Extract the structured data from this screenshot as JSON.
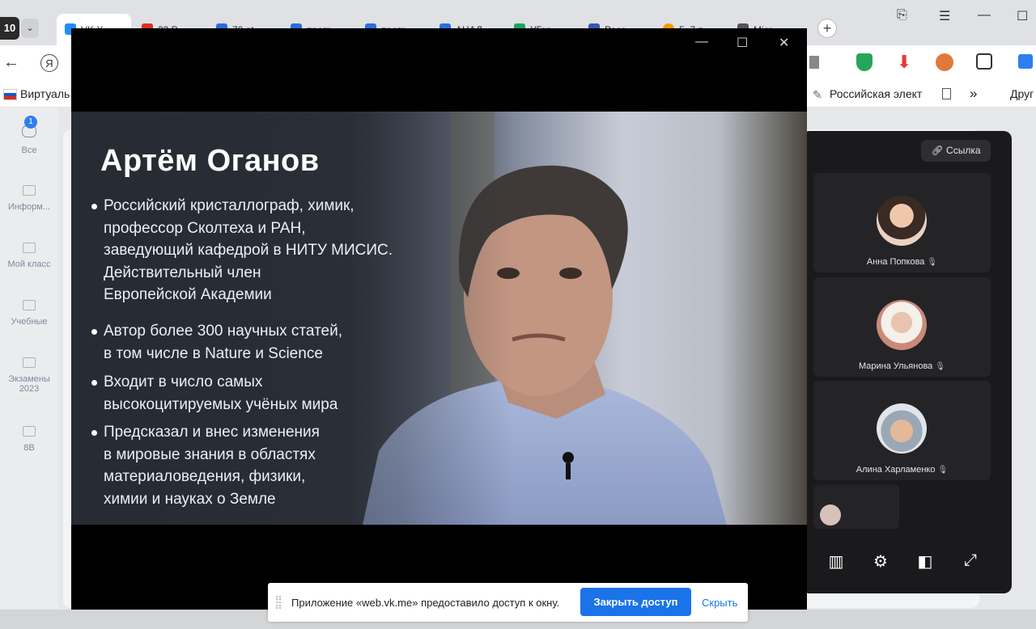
{
  "browser": {
    "tab_count_badge": "10",
    "tabs": [
      {
        "title": "VK X",
        "color": "#1f8cff",
        "active": true
      },
      {
        "title": "33 P",
        "color": "#d93025",
        "active": false
      },
      {
        "title": "70 at",
        "color": "#2a6de0",
        "active": false
      },
      {
        "title": "прогр",
        "color": "#2a6de0",
        "active": false
      },
      {
        "title": "прогр",
        "color": "#2a6de0",
        "active": false
      },
      {
        "title": "АНАЛ",
        "color": "#2a6de0",
        "active": false
      },
      {
        "title": "УГор",
        "color": "#1ea362",
        "active": false
      },
      {
        "title": "Росс",
        "color": "#3955b5",
        "active": false
      },
      {
        "title": "5. 7 п",
        "color": "#f29900",
        "active": false
      },
      {
        "title": "Micr",
        "color": "#555555",
        "active": false
      }
    ],
    "bookmarks": {
      "left": "Виртуаль",
      "right": "Российская элект",
      "more": "»",
      "other": "Друг"
    }
  },
  "sidebar": {
    "badge": "1",
    "items": [
      {
        "label": "Все"
      },
      {
        "label": "Информ..."
      },
      {
        "label": "Мой класс"
      },
      {
        "label": "Учебные"
      },
      {
        "label": "Экзамены 2023"
      },
      {
        "label": "8В"
      }
    ]
  },
  "call": {
    "link_label": "Ссылка",
    "participants": [
      {
        "name": "Анна Попкова"
      },
      {
        "name": "Марина Ульянова"
      },
      {
        "name": "Алина Харламенко"
      }
    ]
  },
  "video": {
    "slide_title": "Артём Оганов",
    "bullets": [
      [
        "Российский кристаллограф, химик,",
        "профессор Сколтеха и РАН,",
        "заведующий кафедрой в НИТУ МИСИС.",
        "Действительный член",
        "Европейской Академии"
      ],
      [
        "Автор более 300 научных статей,",
        "в том числе в Nature и Science"
      ],
      [
        "Входит в число самых",
        "высокоцитируемых учёных мира"
      ],
      [
        "Предсказал и внес изменения",
        "в мировые знания в областях",
        "материаловедения, физики,",
        "химии и науках о Земле"
      ]
    ]
  },
  "sharebar": {
    "message": "Приложение «web.vk.me» предоставило доступ к окну.",
    "stop_label": "Закрыть доступ",
    "hide_label": "Скрыть"
  },
  "colors": {
    "accent": "#1a73e8",
    "call_bg": "#1a1a1c"
  }
}
